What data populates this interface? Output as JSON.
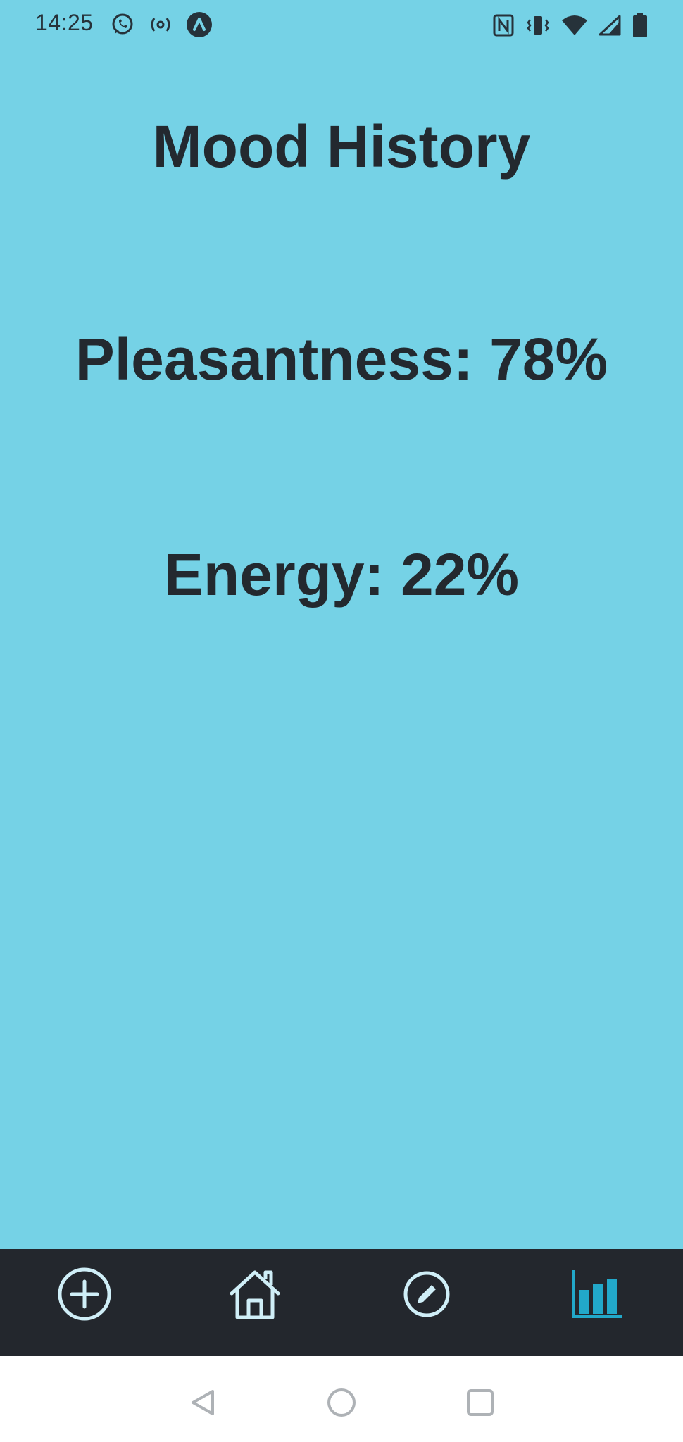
{
  "status_bar": {
    "time": "14:25",
    "left_icons": [
      "whatsapp-icon",
      "hotspot-icon",
      "app-notification-icon"
    ],
    "right_icons": [
      "nfc-icon",
      "vibrate-icon",
      "wifi-icon",
      "cell-signal-icon",
      "battery-icon"
    ]
  },
  "page": {
    "title": "Mood History",
    "pleasantness_text": "Pleasantness: 78%",
    "energy_text": "Energy: 22%",
    "pleasantness_value": 78,
    "energy_value": 22
  },
  "bottom_nav": {
    "items": [
      {
        "icon": "add-circle-icon",
        "active": false
      },
      {
        "icon": "home-icon",
        "active": false
      },
      {
        "icon": "edit-icon",
        "active": false
      },
      {
        "icon": "bar-chart-icon",
        "active": true
      }
    ]
  },
  "system_nav": {
    "buttons": [
      "back-icon",
      "home-circle-icon",
      "recents-icon"
    ]
  },
  "colors": {
    "background": "#75d2e6",
    "text": "#23292f",
    "nav_background": "#23272d",
    "nav_icon": "#cfeef7",
    "nav_active": "#22a8c9"
  }
}
